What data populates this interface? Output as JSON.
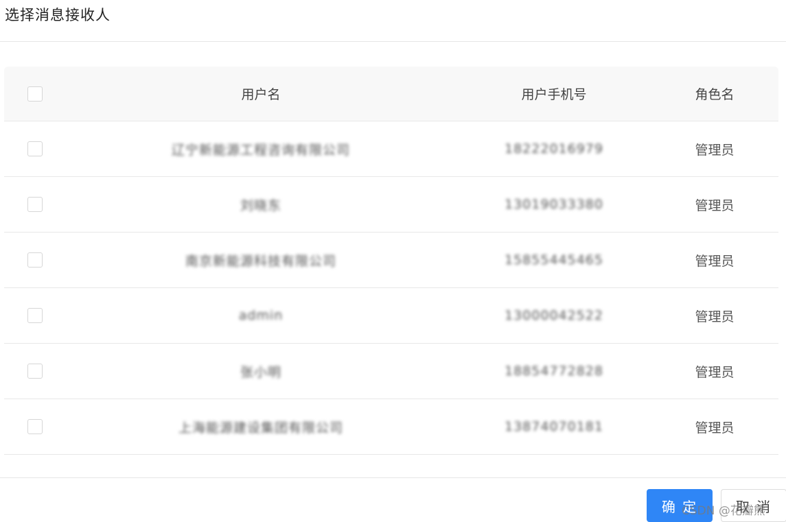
{
  "dialog": {
    "title": "选择消息接收人"
  },
  "table": {
    "columns": {
      "name": "用户名",
      "phone": "用户手机号",
      "role": "角色名"
    },
    "rows": [
      {
        "name": "辽宁新能源工程咨询有限公司",
        "phone": "18222016979",
        "role": "管理员"
      },
      {
        "name": "刘晓东",
        "phone": "13019033380",
        "role": "管理员"
      },
      {
        "name": "南京新能源科技有限公司",
        "phone": "15855445465",
        "role": "管理员"
      },
      {
        "name": "admin",
        "phone": "13000042522",
        "role": "管理员"
      },
      {
        "name": "张小明",
        "phone": "18854772828",
        "role": "管理员"
      },
      {
        "name": "上海能源建设集团有限公司",
        "phone": "13874070181",
        "role": "管理员"
      }
    ]
  },
  "footer": {
    "confirm_label": "确 定",
    "cancel_label": "取 消"
  },
  "watermark": "CSDN @花瓣熊"
}
